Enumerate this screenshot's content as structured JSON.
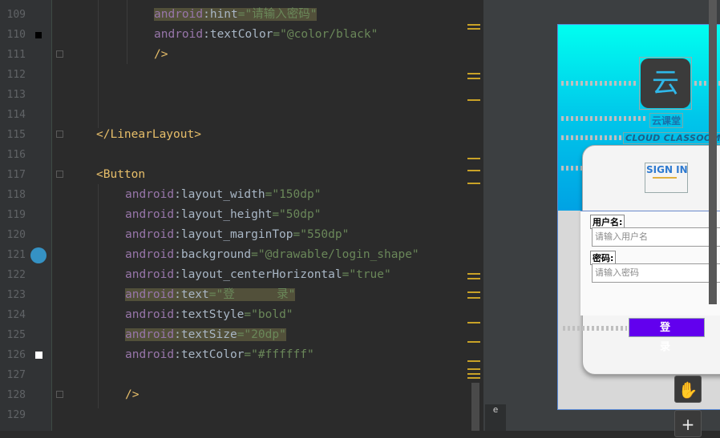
{
  "editor": {
    "lines": [
      {
        "num": "109",
        "ind": 3,
        "parts": [
          {
            "t": "android",
            "c": "attr-ns hl"
          },
          {
            "t": ":hint",
            "c": "punct hl"
          },
          {
            "t": "=\"请输入密码\"",
            "c": "val hl"
          }
        ]
      },
      {
        "num": "110",
        "ind": 3,
        "parts": [
          {
            "t": "android",
            "c": "attr-ns"
          },
          {
            "t": ":textColor",
            "c": "punct"
          },
          {
            "t": "=\"@color/black\"",
            "c": "val"
          }
        ]
      },
      {
        "num": "111",
        "ind": 3,
        "parts": [
          {
            "t": "/>",
            "c": "tag"
          }
        ]
      },
      {
        "num": "112",
        "ind": 0,
        "parts": []
      },
      {
        "num": "113",
        "ind": 0,
        "parts": []
      },
      {
        "num": "114",
        "ind": 0,
        "parts": []
      },
      {
        "num": "115",
        "ind": 1,
        "parts": [
          {
            "t": "</LinearLayout>",
            "c": "tag"
          }
        ]
      },
      {
        "num": "116",
        "ind": 0,
        "parts": []
      },
      {
        "num": "117",
        "ind": 1,
        "parts": [
          {
            "t": "<Button",
            "c": "tag"
          }
        ]
      },
      {
        "num": "118",
        "ind": 2,
        "parts": [
          {
            "t": "android",
            "c": "attr-ns"
          },
          {
            "t": ":layout_width",
            "c": "punct"
          },
          {
            "t": "=\"150dp\"",
            "c": "val"
          }
        ]
      },
      {
        "num": "119",
        "ind": 2,
        "parts": [
          {
            "t": "android",
            "c": "attr-ns"
          },
          {
            "t": ":layout_height",
            "c": "punct"
          },
          {
            "t": "=\"50dp\"",
            "c": "val"
          }
        ]
      },
      {
        "num": "120",
        "ind": 2,
        "parts": [
          {
            "t": "android",
            "c": "attr-ns"
          },
          {
            "t": ":layout_marginTop",
            "c": "punct"
          },
          {
            "t": "=\"550dp\"",
            "c": "val"
          }
        ]
      },
      {
        "num": "121",
        "ind": 2,
        "parts": [
          {
            "t": "android",
            "c": "attr-ns"
          },
          {
            "t": ":background",
            "c": "punct"
          },
          {
            "t": "=\"@drawable/login_shape\"",
            "c": "val"
          }
        ]
      },
      {
        "num": "122",
        "ind": 2,
        "parts": [
          {
            "t": "android",
            "c": "attr-ns"
          },
          {
            "t": ":layout_centerHorizontal",
            "c": "punct"
          },
          {
            "t": "=\"true\"",
            "c": "val"
          }
        ]
      },
      {
        "num": "123",
        "ind": 2,
        "parts": [
          {
            "t": "android",
            "c": "attr-ns hl"
          },
          {
            "t": ":text",
            "c": "punct hl"
          },
          {
            "t": "=\"登      录\"",
            "c": "val hl"
          }
        ]
      },
      {
        "num": "124",
        "ind": 2,
        "parts": [
          {
            "t": "android",
            "c": "attr-ns"
          },
          {
            "t": ":textStyle",
            "c": "punct"
          },
          {
            "t": "=\"bold\"",
            "c": "val"
          }
        ]
      },
      {
        "num": "125",
        "ind": 2,
        "parts": [
          {
            "t": "android",
            "c": "attr-ns hl"
          },
          {
            "t": ":textSize",
            "c": "punct hl"
          },
          {
            "t": "=\"20dp\"",
            "c": "val hl"
          }
        ]
      },
      {
        "num": "126",
        "ind": 2,
        "parts": [
          {
            "t": "android",
            "c": "attr-ns"
          },
          {
            "t": ":textColor",
            "c": "punct"
          },
          {
            "t": "=\"#ffffff\"",
            "c": "val"
          }
        ]
      },
      {
        "num": "127",
        "ind": 0,
        "parts": []
      },
      {
        "num": "128",
        "ind": 2,
        "parts": [
          {
            "t": "/>",
            "c": "tag"
          }
        ]
      },
      {
        "num": "129",
        "ind": 0,
        "parts": []
      }
    ]
  },
  "sidebar": {
    "tab_label": "e"
  },
  "preview": {
    "logo_glyph": "云",
    "app_name": "云课堂",
    "app_subtitle": "CLOUD CLASSOOM",
    "signin_title": "SIGN IN",
    "username_label": "用户名:",
    "username_placeholder": "请输入用户名",
    "password_label": "密码:",
    "password_placeholder": "请输入密码",
    "login_button": "登 录",
    "pan_icon": "hand-icon",
    "zoom_in_icon": "plus-icon",
    "colors": {
      "gradient_top": "#00fff0",
      "gradient_bottom": "#00a2e4",
      "button": "#6200ee"
    }
  }
}
